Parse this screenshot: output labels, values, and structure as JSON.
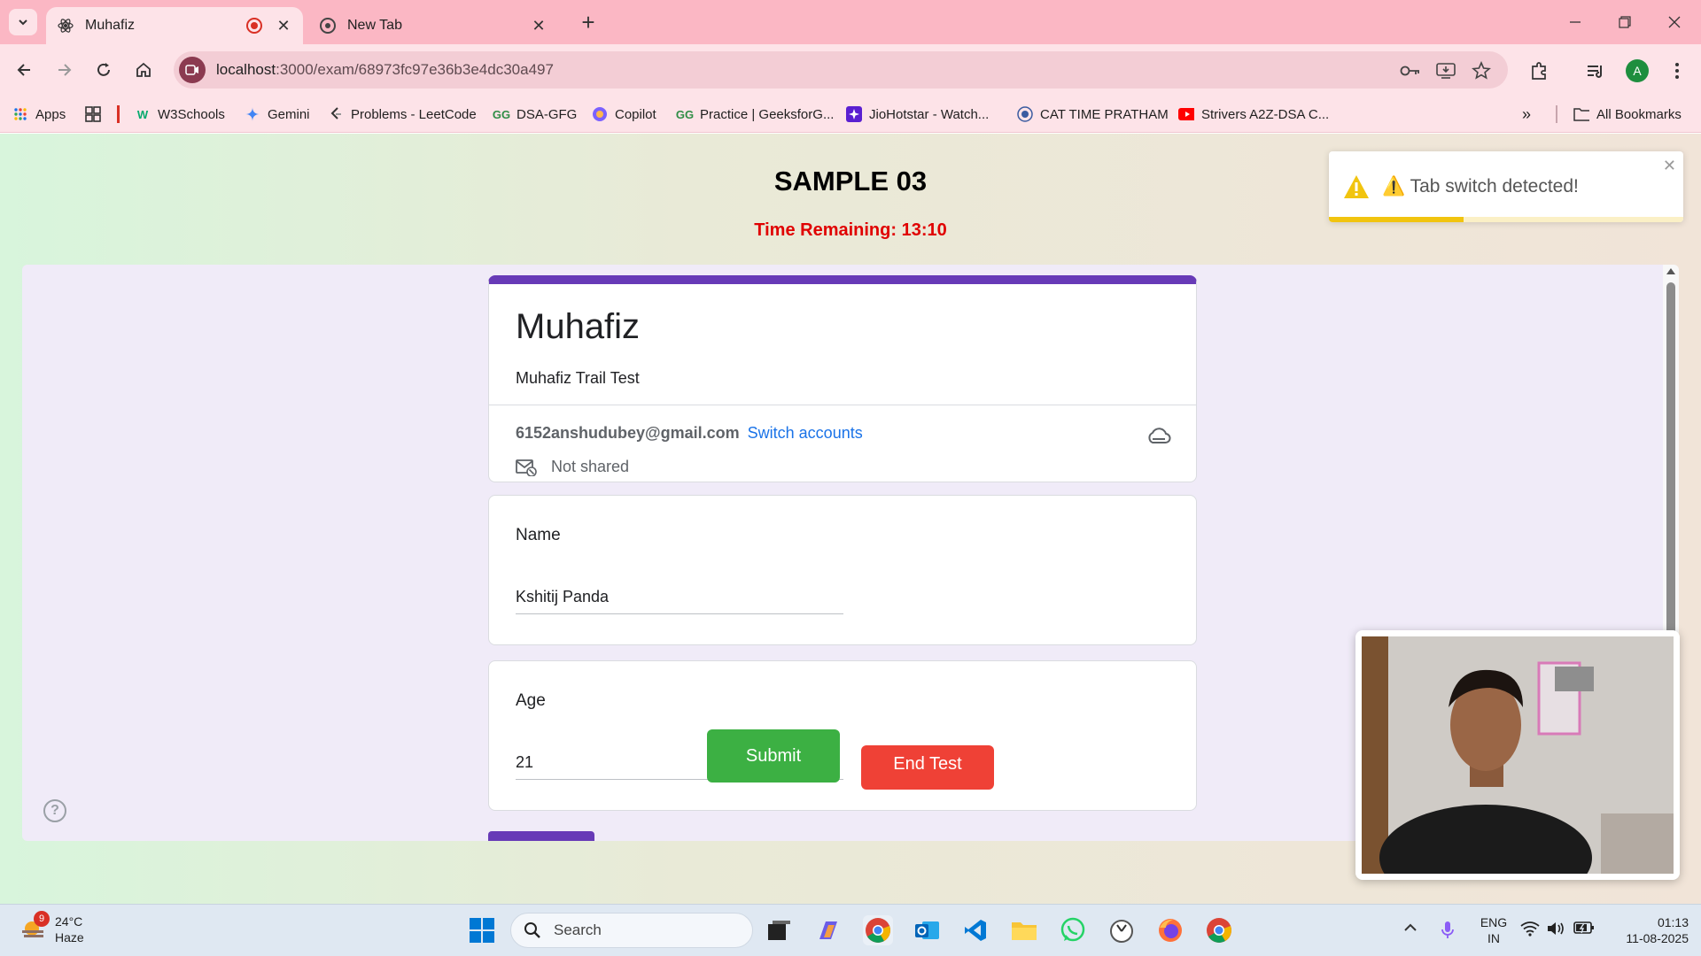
{
  "browser": {
    "tabs": [
      {
        "title": "Muhafiz",
        "active": true,
        "recording": true
      },
      {
        "title": "New Tab",
        "active": false
      }
    ],
    "url_host": "localhost",
    "url_rest": ":3000/exam/68973fc97e36b3e4dc30a497",
    "profile_initial": "A",
    "bookmarks": [
      {
        "label": "Apps",
        "icon": "apps-grid-icon"
      },
      {
        "label": "W3Schools",
        "icon": "w3schools-icon"
      },
      {
        "label": "Gemini",
        "icon": "gemini-icon"
      },
      {
        "label": "Problems - LeetCode",
        "icon": "leetcode-icon"
      },
      {
        "label": "DSA-GFG",
        "icon": "gfg-icon"
      },
      {
        "label": "Copilot",
        "icon": "copilot-icon"
      },
      {
        "label": "Practice | GeeksforG...",
        "icon": "gfg-icon"
      },
      {
        "label": "JioHotstar - Watch...",
        "icon": "hotstar-icon"
      },
      {
        "label": "CAT TIME PRATHAM",
        "icon": "cat-icon"
      },
      {
        "label": "Strivers A2Z-DSA C...",
        "icon": "youtube-icon"
      }
    ],
    "all_bookmarks_label": "All Bookmarks"
  },
  "exam": {
    "title": "SAMPLE 03",
    "timer": "Time Remaining: 13:10",
    "submit_label": "Submit",
    "end_label": "End Test"
  },
  "toast": {
    "message": "⚠️ Tab switch detected!",
    "progress_remaining": 0.38,
    "colors": {
      "accent": "#f1c40f"
    }
  },
  "form": {
    "name": "Muhafiz",
    "description": "Muhafiz Trail Test",
    "email": "6152anshudubey@gmail.com",
    "switch_accounts": "Switch accounts",
    "shared_status": "Not shared",
    "accent_color": "#673ab7",
    "questions": [
      {
        "label": "Name",
        "answer": "Kshitij Panda"
      },
      {
        "label": "Age",
        "answer": "21"
      }
    ]
  },
  "taskbar": {
    "weather_temp": "24°C",
    "weather_desc": "Haze",
    "notification_count": "9",
    "search_placeholder": "Search",
    "lang_top": "ENG",
    "lang_bottom": "IN",
    "time": "01:13",
    "date": "11-08-2025"
  }
}
